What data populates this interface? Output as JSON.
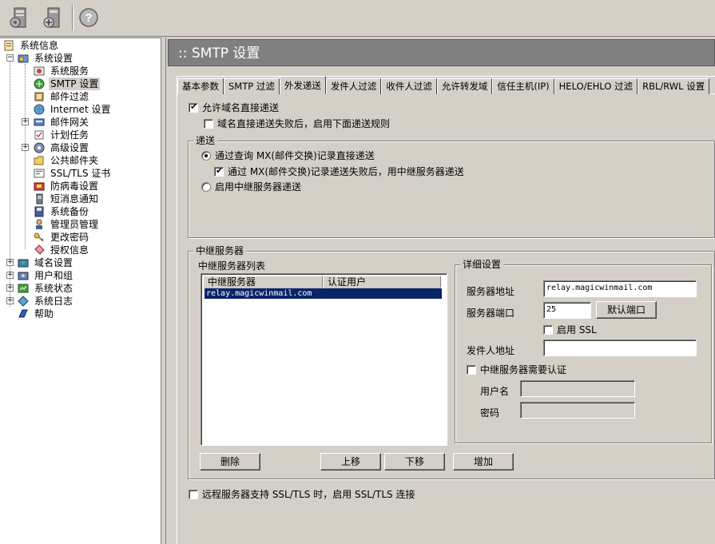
{
  "toolbar": {
    "icons": [
      "computer-gear-icon",
      "computer-settings-icon",
      "help-icon"
    ],
    "help_glyph": "?"
  },
  "tree": {
    "items": [
      {
        "label": "系统信息"
      },
      {
        "label": "系统设置"
      },
      {
        "label": "系统服务"
      },
      {
        "label": "SMTP 设置"
      },
      {
        "label": "邮件过滤"
      },
      {
        "label": "Internet 设置"
      },
      {
        "label": "邮件网关"
      },
      {
        "label": "计划任务"
      },
      {
        "label": "高级设置"
      },
      {
        "label": "公共邮件夹"
      },
      {
        "label": "SSL/TLS 证书"
      },
      {
        "label": "防病毒设置"
      },
      {
        "label": "短消息通知"
      },
      {
        "label": "系统备份"
      },
      {
        "label": "管理员管理"
      },
      {
        "label": "更改密码"
      },
      {
        "label": "授权信息"
      },
      {
        "label": "域名设置"
      },
      {
        "label": "用户和组"
      },
      {
        "label": "系统状态"
      },
      {
        "label": "系统日志"
      },
      {
        "label": "帮助"
      }
    ]
  },
  "header": {
    "title": ":: SMTP 设置"
  },
  "tabs": [
    "基本参数",
    "SMTP 过滤",
    "外发递送",
    "发件人过滤",
    "收件人过滤",
    "允许转发域",
    "信任主机(IP)",
    "HELO/EHLO 过滤",
    "RBL/RWL 设置"
  ],
  "options": {
    "allow_direct": "允许域名直接递送",
    "fallback_rules": "域名直接递送失败后，启用下面递送规则"
  },
  "delivery": {
    "legend": "递送",
    "mx_direct": "通过查询 MX(邮件交换)记录直接递送",
    "mx_fallback": "通过 MX(邮件交换)记录递送失败后，用中继服务器递送",
    "use_relay": "启用中继服务器递送"
  },
  "relay": {
    "legend": "中继服务器",
    "list_label": "中继服务器列表",
    "columns": [
      "中继服务器",
      "认证用户"
    ],
    "rows": [
      "relay.magicwinmail.com"
    ],
    "details": {
      "legend": "详细设置",
      "server_label": "服务器地址",
      "server_value": "relay.magicwinmail.com",
      "port_label": "服务器端口",
      "port_value": "25",
      "default_port_btn": "默认端口",
      "ssl_label": "启用 SSL",
      "sender_label": "发件人地址",
      "sender_value": "",
      "auth_label": "中继服务器需要认证",
      "user_label": "用户名",
      "password_label": "密码"
    },
    "buttons": {
      "delete": "删除",
      "up": "上移",
      "down": "下移",
      "add": "增加"
    }
  },
  "remote_ssl": "远程服务器支持 SSL/TLS 时，启用 SSL/TLS 连接"
}
